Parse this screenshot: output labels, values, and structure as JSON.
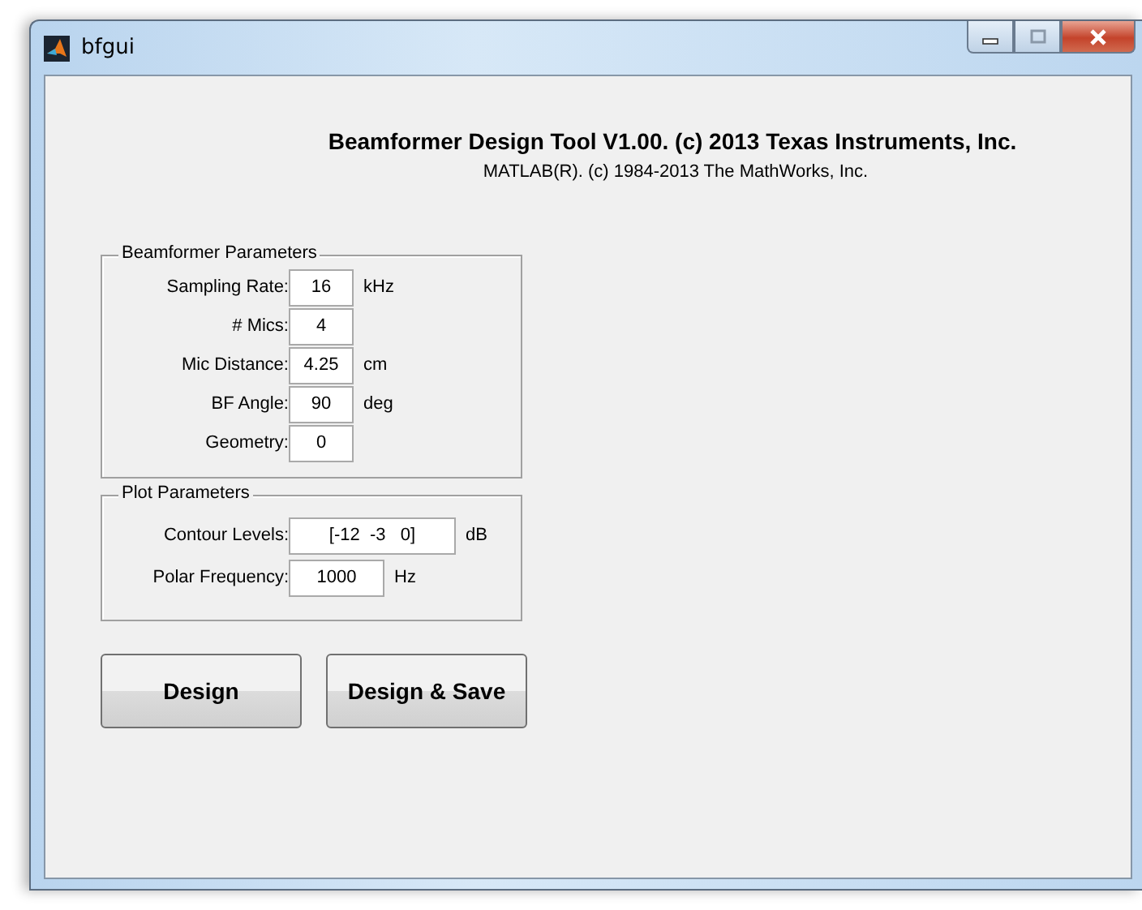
{
  "window": {
    "title": "bfgui"
  },
  "header": {
    "title": "Beamformer Design Tool V1.00. (c) 2013 Texas Instruments, Inc.",
    "subtitle": "MATLAB(R). (c) 1984-2013 The MathWorks, Inc."
  },
  "groups": [
    {
      "title": "Beamformer Parameters",
      "kind": "narrow",
      "fields": [
        {
          "label": "Sampling Rate:",
          "value": "16",
          "unit": "kHz"
        },
        {
          "label": "# Mics:",
          "value": "4"
        },
        {
          "label": "Mic Distance:",
          "value": "4.25",
          "unit": "cm"
        },
        {
          "label": "BF Angle:",
          "value": "90",
          "unit": "deg"
        },
        {
          "label": "Geometry:",
          "value": "0"
        }
      ]
    },
    {
      "title": "Plot Parameters",
      "kind": "mixed",
      "fields": [
        {
          "label": "Contour Levels:",
          "value": "[-12  -3   0]",
          "unit": "dB",
          "kind": "wide"
        },
        {
          "label": "Polar Frequency:",
          "value": "1000",
          "unit": "Hz",
          "kind": "medium"
        }
      ]
    }
  ],
  "buttons": [
    "Design",
    "Design & Save"
  ]
}
